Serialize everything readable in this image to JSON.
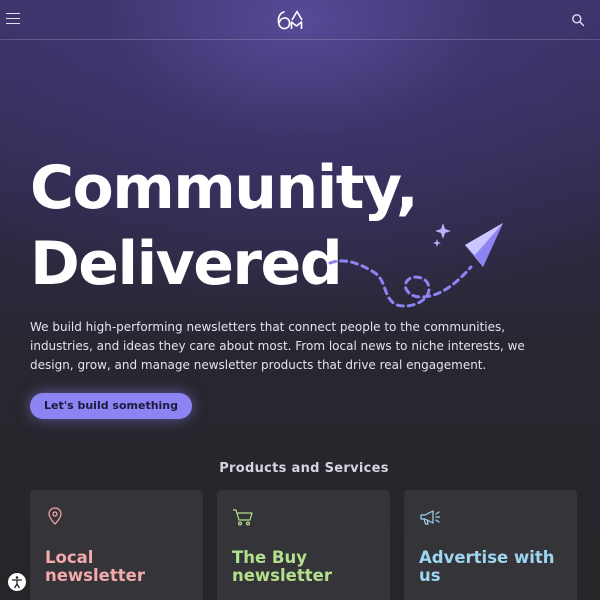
{
  "header": {
    "logo_text": "6AM",
    "menu_icon": "hamburger-menu-icon",
    "search_icon": "search-icon"
  },
  "hero": {
    "title_line1": "Community,",
    "title_line2": "Delivered",
    "description": "We build high-performing newsletters that connect people to the communities, industries, and ideas they care about most. From local news to niche interests, we design, grow, and manage newsletter products that drive real engagement.",
    "cta_label": "Let's build something",
    "illustration_icon": "paper-plane-icon"
  },
  "products": {
    "heading": "Products and Services",
    "cards": [
      {
        "title": "Local newsletter",
        "icon": "map-pin-icon",
        "color": "#f4a9ab"
      },
      {
        "title": "The Buy newsletter",
        "icon": "shopping-cart-icon",
        "color": "#b4e08c"
      },
      {
        "title": "Advertise with us",
        "icon": "megaphone-icon",
        "color": "#9ed6f2"
      }
    ]
  },
  "accessibility": {
    "icon": "accessibility-icon"
  },
  "colors": {
    "accent": "#8d84f3",
    "background": "#25242a"
  }
}
